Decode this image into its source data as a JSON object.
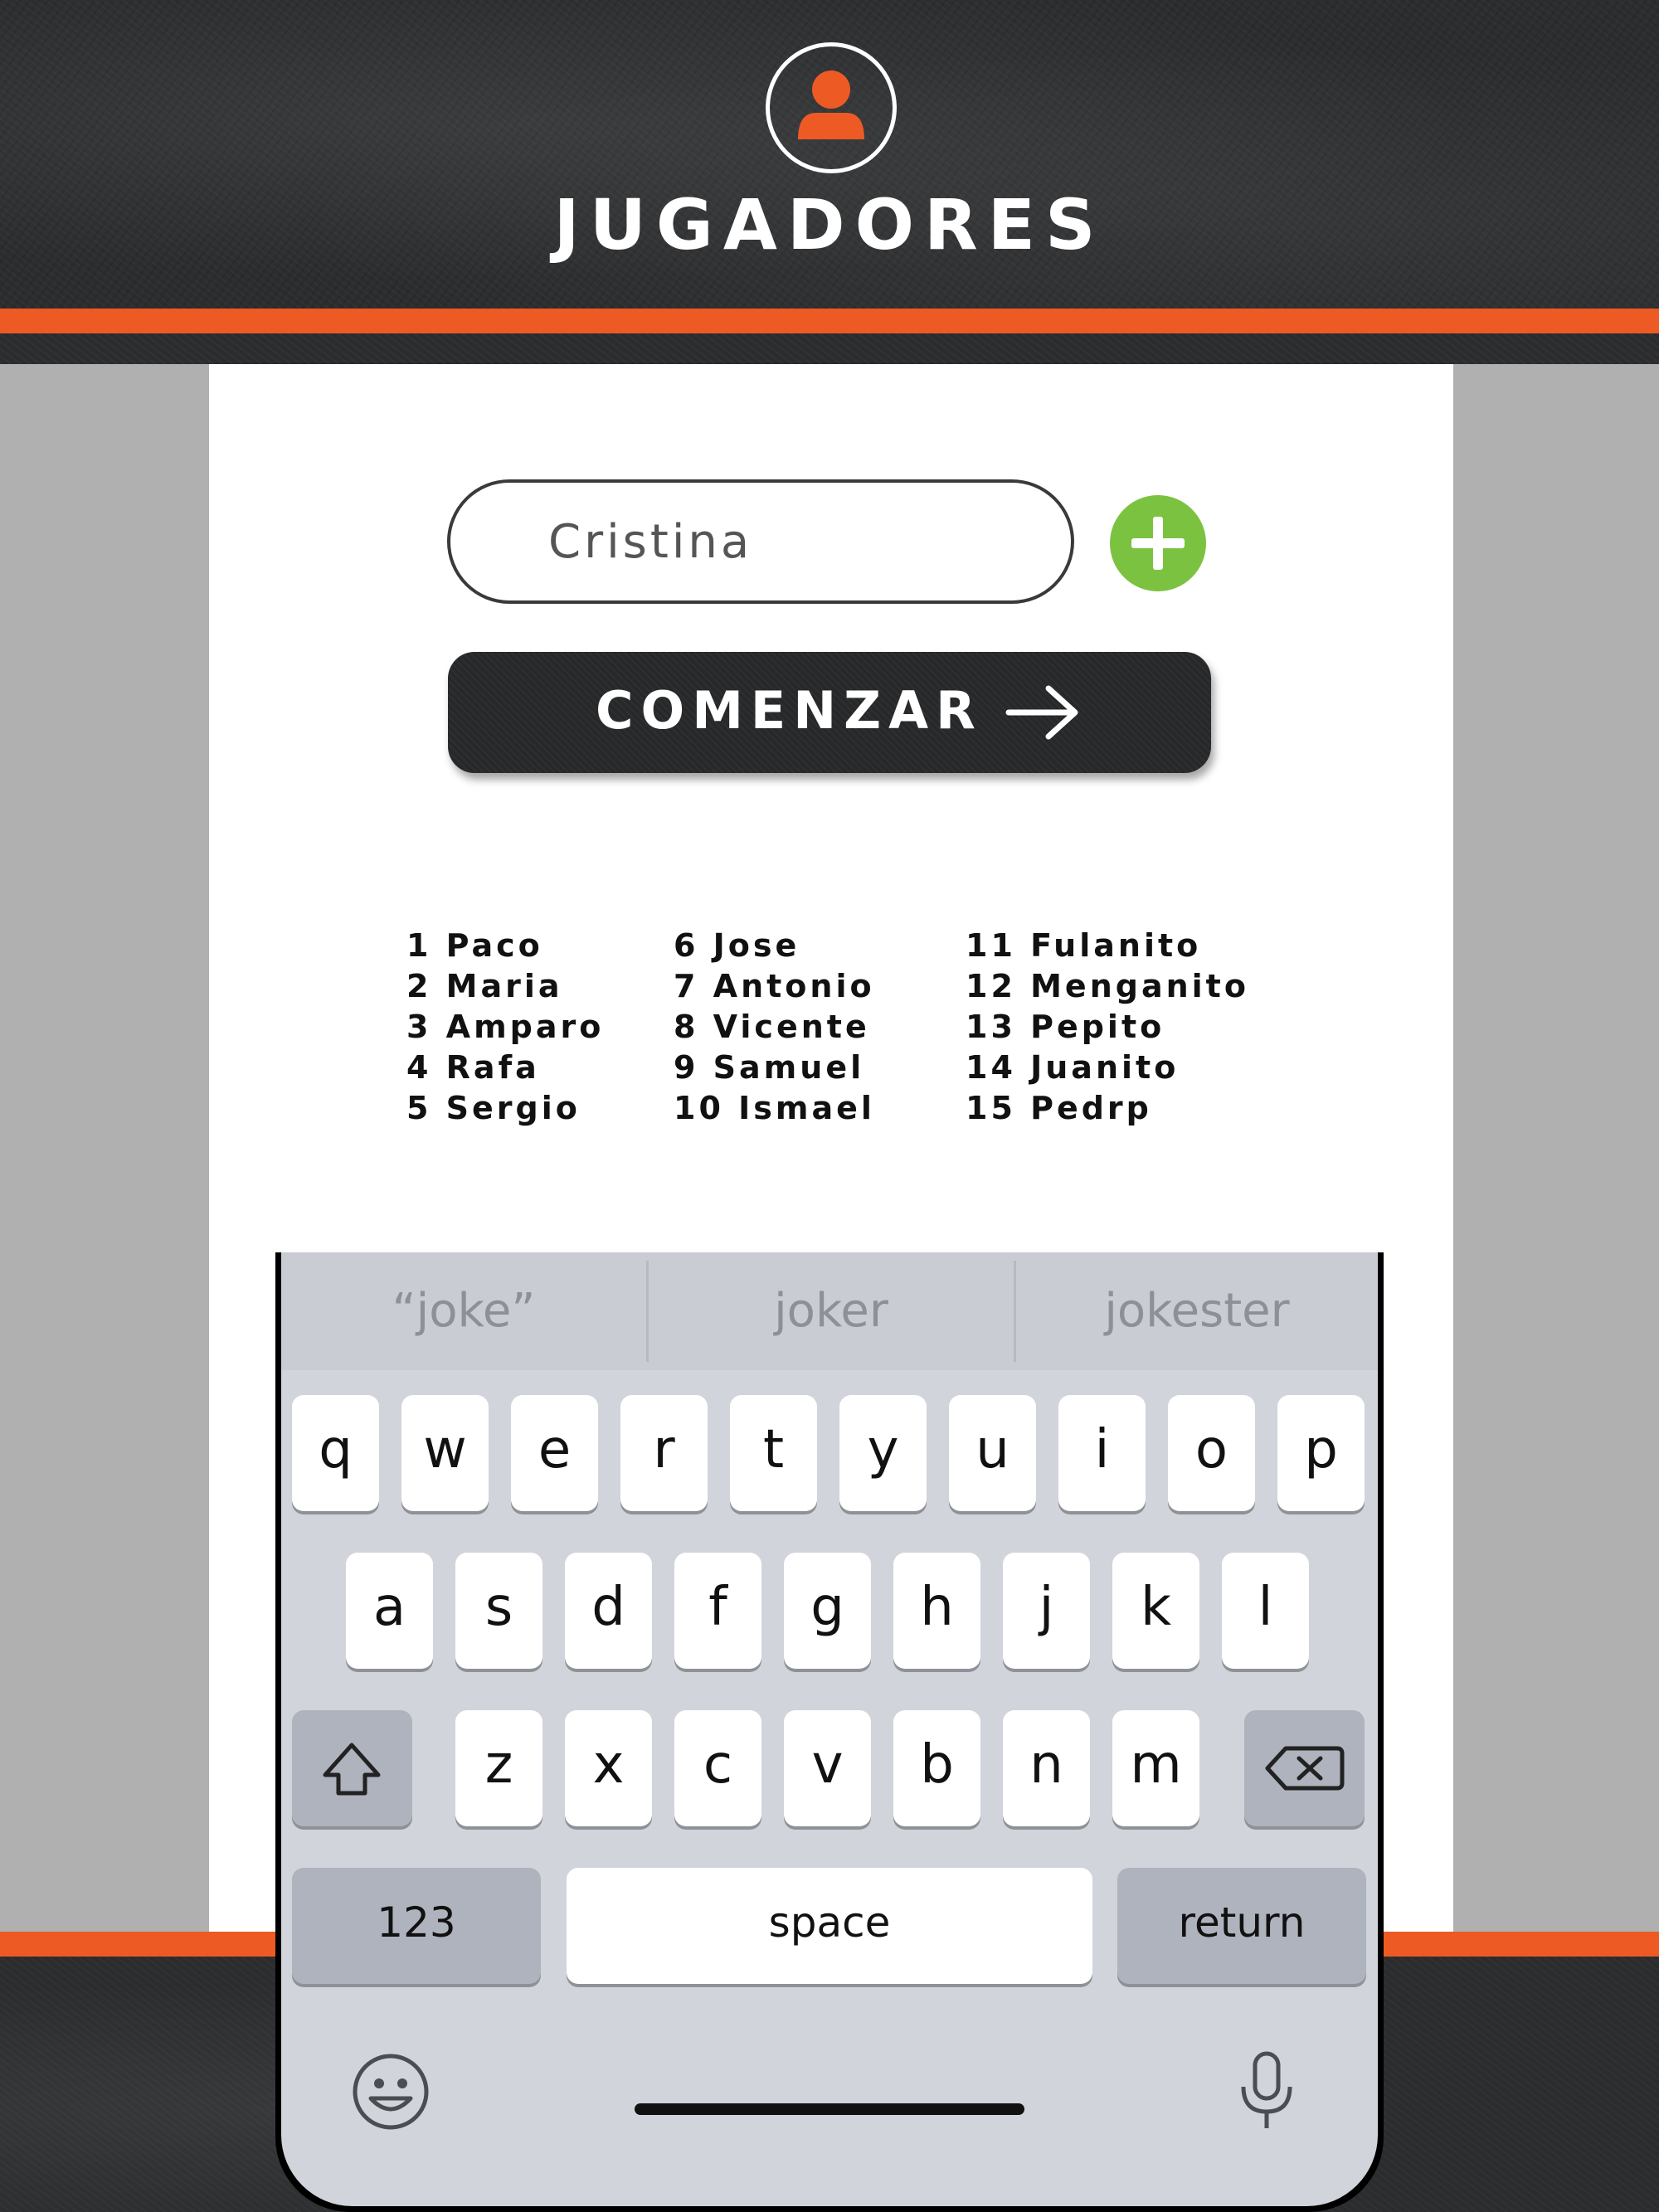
{
  "header": {
    "title": "JUGADORES",
    "avatar_icon": "user-icon",
    "accent_color": "#ee5a24"
  },
  "form": {
    "name_value": "Cristina",
    "add_icon": "plus-icon",
    "add_color": "#7cc241",
    "start_label": "COMENZAR",
    "start_icon": "arrow-right-icon"
  },
  "players": {
    "col1": [
      "1 Paco",
      "2 Maria",
      "3 Amparo",
      "4 Rafa",
      "5 Sergio"
    ],
    "col2": [
      "6 Jose",
      "7 Antonio",
      "8 Vicente",
      "9 Samuel",
      "10 Ismael"
    ],
    "col3": [
      "11 Fulanito",
      "12 Menganito",
      "13 Pepito",
      "14 Juanito",
      "15 Pedrp"
    ]
  },
  "keyboard": {
    "suggestions": [
      "“joke”",
      "joker",
      "jokester"
    ],
    "row1": [
      "q",
      "w",
      "e",
      "r",
      "t",
      "y",
      "u",
      "i",
      "o",
      "p"
    ],
    "row2": [
      "a",
      "s",
      "d",
      "f",
      "g",
      "h",
      "j",
      "k",
      "l"
    ],
    "row3": [
      "z",
      "x",
      "c",
      "v",
      "b",
      "n",
      "m"
    ],
    "shift_icon": "shift-icon",
    "backspace_icon": "backspace-icon",
    "numbers_label": "123",
    "space_label": "space",
    "return_label": "return",
    "emoji_icon": "emoji-icon",
    "mic_icon": "microphone-icon"
  }
}
